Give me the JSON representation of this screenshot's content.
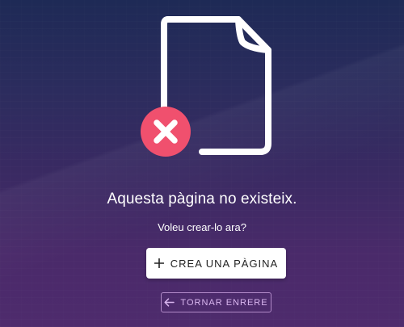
{
  "page": {
    "background_top": "#1e2a56",
    "background_bottom": "#4e2b6d"
  },
  "illustration": {
    "icon": "missing-document-icon",
    "badge_icon": "close-icon",
    "badge_color": "#f0506e",
    "stroke_color": "#ffffff"
  },
  "message": {
    "title": "Aquesta pàgina no existeix.",
    "subtitle": "Voleu crear-lo ara?"
  },
  "actions": {
    "create_label": "CREA UNA PÀGINA",
    "create_icon": "plus-icon",
    "back_label": "TORNAR ENRERE",
    "back_icon": "arrow-left-icon",
    "back_color": "#d9b6ef"
  }
}
